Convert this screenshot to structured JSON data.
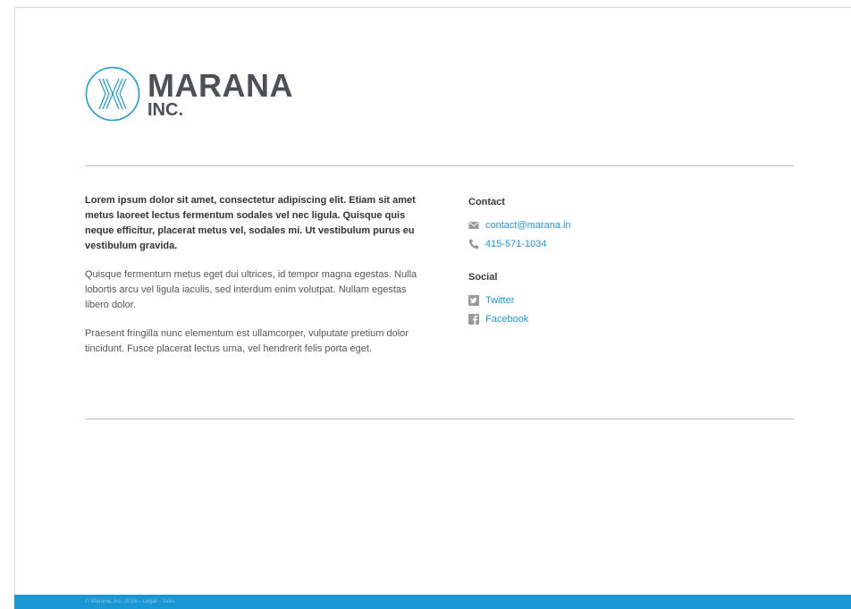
{
  "brand": {
    "name": "MARANA",
    "suffix": "INC.",
    "accent_color": "#1e9ad6",
    "text_color": "#4d5156",
    "logo_icon": "marana-logo-icon"
  },
  "intro": {
    "lead": "Lorem ipsum dolor sit amet, consectetur adipiscing elit. Etiam sit amet metus laoreet lectus fermentum sodales vel nec ligula. Quisque quis neque efficitur, placerat metus vel, sodales mi. Ut vestibulum purus eu vestibulum gravida.",
    "paragraph_2": "Quisque fermentum metus eget dui ultrices, id tempor magna egestas. Nulla lobortis arcu vel ligula iaculis, sed interdum enim volutpat. Nullam egestas libero dolor.",
    "paragraph_3": "Praesent fringilla nunc elementum est ullamcorper, vulputate pretium dolor tincidunt. Fusce placerat lectus urna, vel hendrerit felis porta eget."
  },
  "contact": {
    "heading": "Contact",
    "email": {
      "label": "contact@marana.in",
      "icon": "mail-icon"
    },
    "phone": {
      "label": "415-571-1034",
      "icon": "phone-icon"
    }
  },
  "social": {
    "heading": "Social",
    "twitter": {
      "label": "Twitter",
      "icon": "twitter-icon"
    },
    "facebook": {
      "label": "Facebook",
      "icon": "facebook-icon"
    }
  },
  "footer": {
    "copyright": "© Marana, Inc. 2016",
    "separator": " - ",
    "legal": "Legal",
    "jobs": "Jobs",
    "background_color": "#1a98d5"
  }
}
